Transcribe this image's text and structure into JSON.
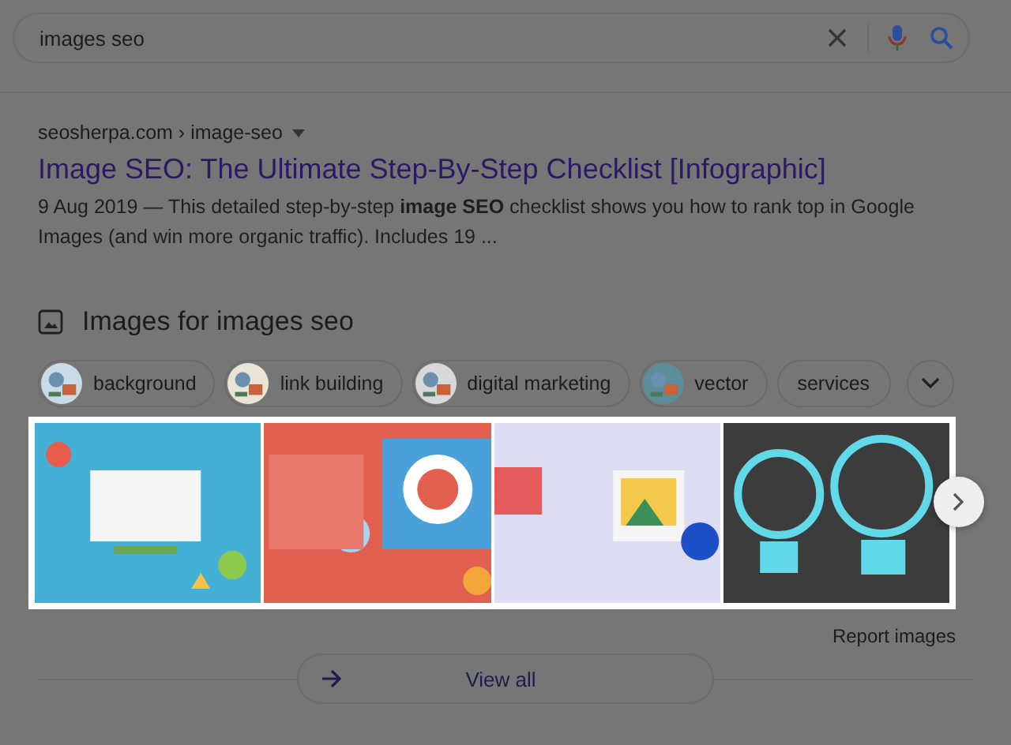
{
  "search": {
    "value": "images seo"
  },
  "result": {
    "breadcrumb": "seosherpa.com › image-seo",
    "title": "Image SEO: The Ultimate Step-By-Step Checklist [Infographic]",
    "snippet": "9 Aug 2019 — This detailed step-by-step **image SEO** checklist shows you how to rank top in Google Images (and win more organic traffic). Includes 19 ..."
  },
  "images_section": {
    "heading": "Images for images seo",
    "chips": [
      {
        "label": "background",
        "thumbnail": true
      },
      {
        "label": "link building",
        "thumbnail": true
      },
      {
        "label": "digital marketing",
        "thumbnail": true
      },
      {
        "label": "vector",
        "thumbnail": true
      },
      {
        "label": "services",
        "thumbnail": false
      }
    ],
    "report_link": "Report images",
    "view_all": "View all"
  }
}
